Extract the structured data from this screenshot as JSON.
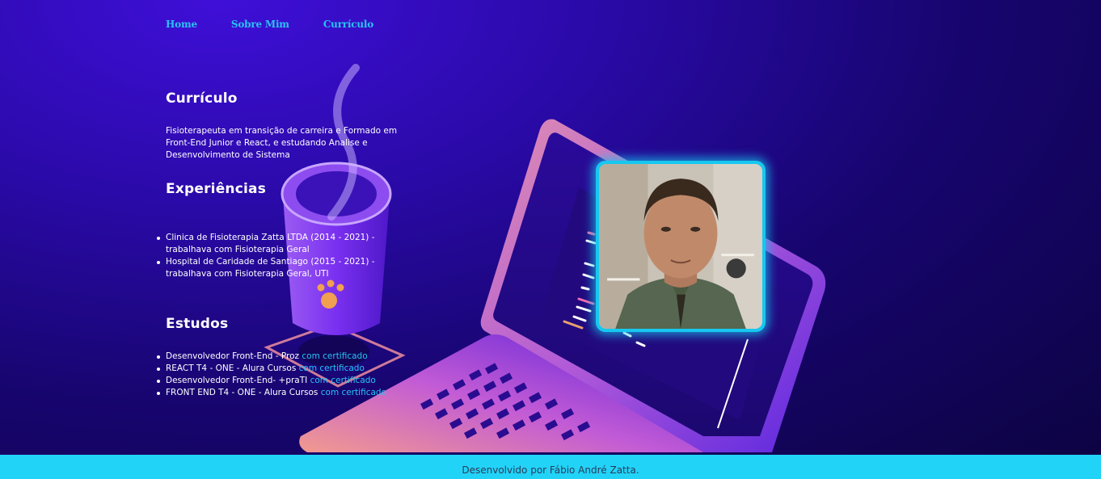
{
  "nav": {
    "items": [
      {
        "label": "Home"
      },
      {
        "label": "Sobre Mim"
      },
      {
        "label": "Currículo"
      }
    ]
  },
  "curriculo": {
    "title": "Currículo",
    "summary": "Fisioterapeuta em transição de carreira e Formado em Front-End Junior e React, e estudando Analise e Desenvolvimento de Sistema"
  },
  "experiencias": {
    "title": "Experiências",
    "items": [
      {
        "text": "Clinica de Fisioterapia Zatta LTDA (2014 - 2021) - trabalhava com Fisioterapia Geral"
      },
      {
        "text": "Hospital de Caridade de Santiago (2015 - 2021) - trabalhava com Fisioterapia Geral, UTI"
      }
    ]
  },
  "estudos": {
    "title": "Estudos",
    "items": [
      {
        "text": "Desenvolvedor Front-End - Proz ",
        "link": "com certificado"
      },
      {
        "text": "REACT T4 - ONE - Alura Cursos ",
        "link": "com certificado"
      },
      {
        "text": "Desenvolvedor Front-End- +praTI ",
        "link": "com certificado"
      },
      {
        "text": "FRONT END T4 - ONE - Alura Cursos ",
        "link": "com certificado"
      }
    ]
  },
  "footer": {
    "text": "Desenvolvido por Fábio André Zatta."
  },
  "colors": {
    "accent": "#27c4f5",
    "footer_bg": "#22d3f8",
    "bg_dark": "#17056e"
  }
}
